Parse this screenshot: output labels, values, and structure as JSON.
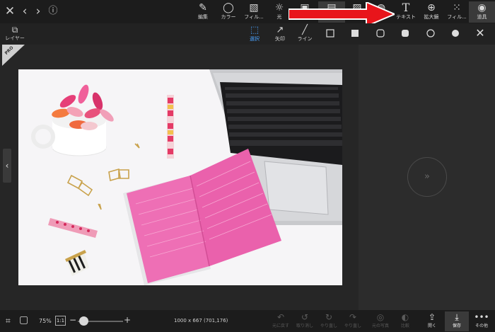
{
  "toolbar": {
    "tools": [
      {
        "label": "編集",
        "icon": "edit-icon"
      },
      {
        "label": "カラー",
        "icon": "color-circle-icon"
      },
      {
        "label": "フィル...",
        "icon": "filter-frame-icon"
      },
      {
        "label": "光",
        "icon": "sun-icon"
      },
      {
        "label": "",
        "icon": "frame-icon"
      },
      {
        "label": "",
        "icon": "sticker-icon"
      },
      {
        "label": "",
        "icon": "image-icon"
      },
      {
        "label": "",
        "icon": "effect-icon"
      },
      {
        "label": "テキスト",
        "icon": "text-icon"
      },
      {
        "label": "拡大鏡",
        "icon": "magnifier-icon"
      },
      {
        "label": "フィル...",
        "icon": "grid-dots-icon"
      },
      {
        "label": "道具",
        "icon": "palette-icon"
      }
    ]
  },
  "subbar": {
    "select_label": "選択",
    "arrow_label": "矢印",
    "line_label": "ライン"
  },
  "layer": {
    "label": "レイヤー"
  },
  "pro_badge": "PRO",
  "zoom": {
    "level": "75%",
    "ratio": "1:1",
    "value": 0.12
  },
  "image_info": "1000 x 667 (701,176)",
  "bottom": {
    "undo": "元に戻す",
    "undo2": "取り消し",
    "redo": "やり直し",
    "redo2": "やり直し",
    "original": "元の写真",
    "compare": "比較",
    "open": "開く",
    "save": "保存",
    "more": "その他"
  },
  "colors": {
    "accent": "#4aa3ff",
    "arrow": "#e8151b",
    "notebook": "#ee6fb5"
  }
}
